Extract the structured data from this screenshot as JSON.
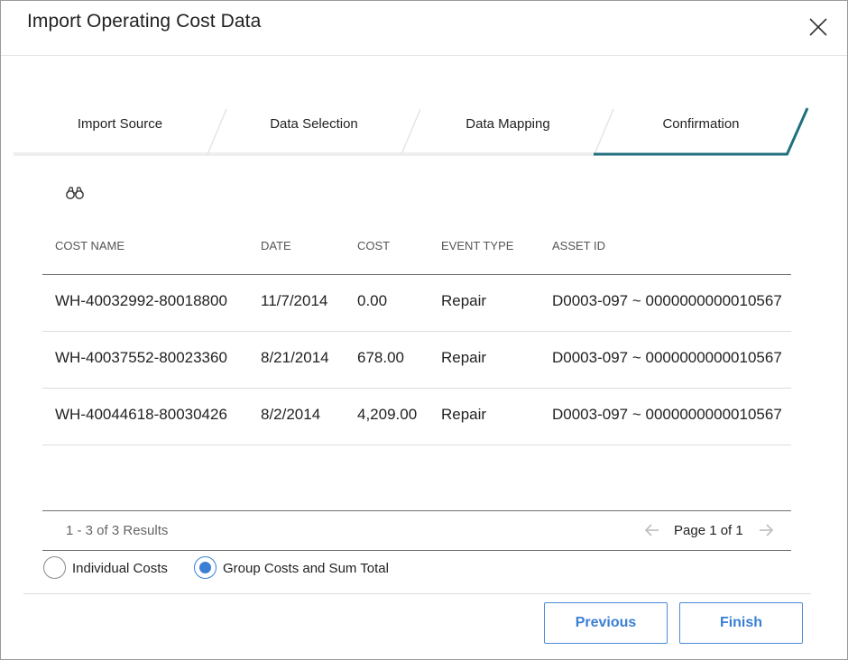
{
  "dialog": {
    "title": "Import Operating Cost Data"
  },
  "steps": [
    {
      "label": "Import Source",
      "active": false
    },
    {
      "label": "Data Selection",
      "active": false
    },
    {
      "label": "Data Mapping",
      "active": false
    },
    {
      "label": "Confirmation",
      "active": true
    }
  ],
  "colors": {
    "active_step": "#1f6f7e",
    "accent": "#3a7fd5"
  },
  "table": {
    "columns": [
      "COST NAME",
      "DATE",
      "COST",
      "EVENT TYPE",
      "ASSET ID"
    ],
    "rows": [
      [
        "WH-40032992-80018800",
        "11/7/2014",
        "0.00",
        "Repair",
        "D0003-097 ~ 0000000000010567"
      ],
      [
        "WH-40037552-80023360",
        "8/21/2014",
        "678.00",
        "Repair",
        "D0003-097 ~ 0000000000010567"
      ],
      [
        "WH-40044618-80030426",
        "8/2/2014",
        "4,209.00",
        "Repair",
        "D0003-097 ~ 0000000000010567"
      ]
    ]
  },
  "pager": {
    "results_text": "1 - 3 of 3 Results",
    "page_text": "Page 1 of 1"
  },
  "options": [
    {
      "label": "Individual Costs",
      "checked": false
    },
    {
      "label": "Group Costs and Sum Total",
      "checked": true
    }
  ],
  "buttons": {
    "previous": "Previous",
    "finish": "Finish"
  }
}
